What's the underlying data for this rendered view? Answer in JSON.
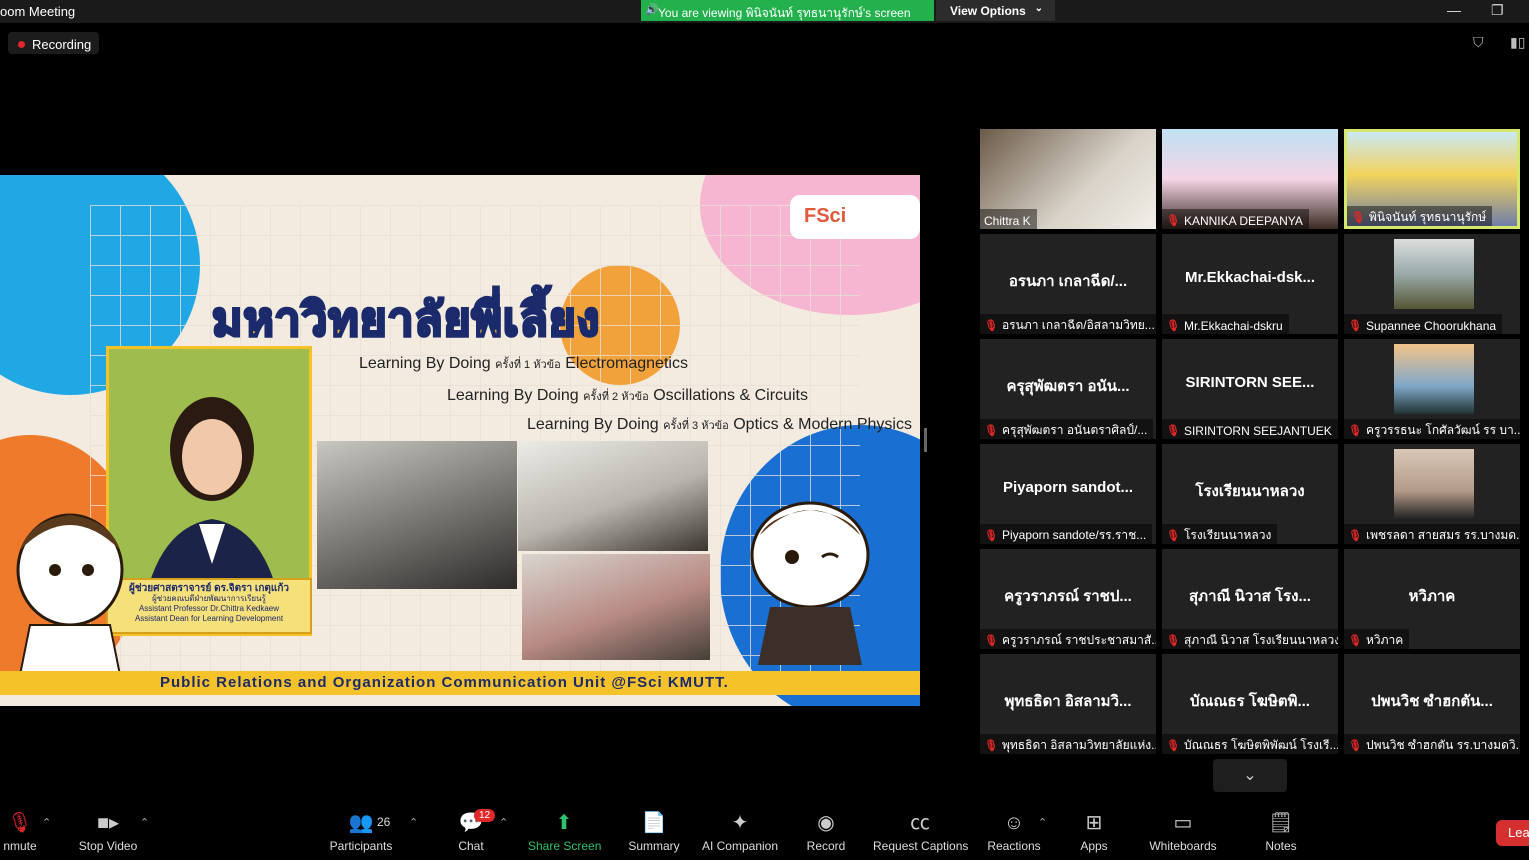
{
  "window": {
    "title": "oom Meeting",
    "minimize": "—",
    "maximize": "❐"
  },
  "banner": {
    "text": "You are viewing พินิจนันท์ รุทธนานุรักษ์'s screen",
    "view_options": "View Options"
  },
  "recording": {
    "label": "Recording"
  },
  "shared_screen": {
    "thai_title": "มหาวิทยาลัยพี่เลี้ยง",
    "logo": "FSci",
    "lines": [
      {
        "prefix": "Learning By Doing",
        "small": "ครั้งที่ 1 หัวข้อ",
        "topic": "Electromagnetics"
      },
      {
        "prefix": "Learning By Doing",
        "small": "ครั้งที่ 2 หัวข้อ",
        "topic": "Oscillations & Circuits"
      },
      {
        "prefix": "Learning By Doing",
        "small": "ครั้งที่ 3 หัวข้อ",
        "topic": "Optics & Modern Physics"
      }
    ],
    "caption": {
      "line1": "ผู้ช่วยศาสตราจารย์ ดร.จิตรา เกตุแก้ว",
      "line2": "ผู้ช่วยคณบดีฝ่ายพัฒนาการเรียนรู้",
      "line3": "Assistant Professor Dr.Chittra Kedkaew",
      "line4": "Assistant Dean for Learning Development"
    },
    "footer": "Public Relations and Organization Communication Unit @FSci KMUTT."
  },
  "gallery": [
    {
      "center": "",
      "label": "Chittra K",
      "muted": false,
      "video": true
    },
    {
      "center": "",
      "label": "KANNIKA DEEPANYA",
      "muted": true,
      "video": true
    },
    {
      "center": "",
      "label": "พินิจนันท์ รุทธนานุรักษ์",
      "muted": true,
      "video": true
    },
    {
      "center": "อรนภา เกลาฉีด/...",
      "label": "อรนภา เกลาฉีด/อิสลามวิทย...",
      "muted": true,
      "video": false
    },
    {
      "center": "Mr.Ekkachai-dsk...",
      "label": "Mr.Ekkachai-dskru",
      "muted": true,
      "video": false
    },
    {
      "center": "",
      "label": "Supannee Choorukhana",
      "muted": true,
      "video": true
    },
    {
      "center": "ครุสุพัฒตรา อนัน...",
      "label": "ครุสุพัฒตรา อนันตราศิลป์/...",
      "muted": true,
      "video": false
    },
    {
      "center": "SIRINTORN SEE...",
      "label": "SIRINTORN SEEJANTUEK",
      "muted": true,
      "video": false
    },
    {
      "center": "",
      "label": "ครูวรรธนะ โกศัลวัฒน์ รร บา...",
      "muted": true,
      "video": true
    },
    {
      "center": "Piyaporn sandot...",
      "label": "Piyaporn sandote/รร.ราช...",
      "muted": true,
      "video": false
    },
    {
      "center": "โรงเรียนนาหลวง",
      "label": "โรงเรียนนาหลวง",
      "muted": true,
      "video": false
    },
    {
      "center": "",
      "label": "เพชรลดา สายสมร รร.บางมด...",
      "muted": true,
      "video": true
    },
    {
      "center": "ครูวราภรณ์ ราชป...",
      "label": "ครูวราภรณ์ ราชประชาสมาสั...",
      "muted": true,
      "video": false
    },
    {
      "center": "สุภาณี นิวาส โรง...",
      "label": "สุภาณี นิวาส โรงเรียนนาหลวง",
      "muted": true,
      "video": false
    },
    {
      "center": "หวิภาค",
      "label": "หวิภาค",
      "muted": true,
      "video": false
    },
    {
      "center": "พุทธธิดา อิสลามวิ...",
      "label": "พุทธธิดา อิสลามวิทยาลัยแห่ง...",
      "muted": true,
      "video": false
    },
    {
      "center": "บัณณธร โฆษิตพิ...",
      "label": "บัณณธร โฆษิตพิพัฒน์ โรงเรี...",
      "muted": true,
      "video": false
    },
    {
      "center": "ปพนวิช ซำฮกตัน...",
      "label": "ปพนวิช ซำฮกตัน รร.บางมดวิ...",
      "muted": true,
      "video": false
    }
  ],
  "toolbar": {
    "unmute": "nmute",
    "stop_video": "Stop Video",
    "participants": "Participants",
    "participants_count": "26",
    "chat": "Chat",
    "chat_badge": "12",
    "share_screen": "Share Screen",
    "summary": "Summary",
    "ai_companion": "AI Companion",
    "record": "Record",
    "captions": "Request Captions",
    "reactions": "Reactions",
    "apps": "Apps",
    "whiteboards": "Whiteboards",
    "notes": "Notes",
    "leave": "Lea"
  },
  "colors": {
    "share_green": "#22b14c",
    "active_border": "#d5e86d",
    "muted_red": "#e02828",
    "slide_yellow": "#f6c22a",
    "slide_navy": "#1b2a6b"
  }
}
